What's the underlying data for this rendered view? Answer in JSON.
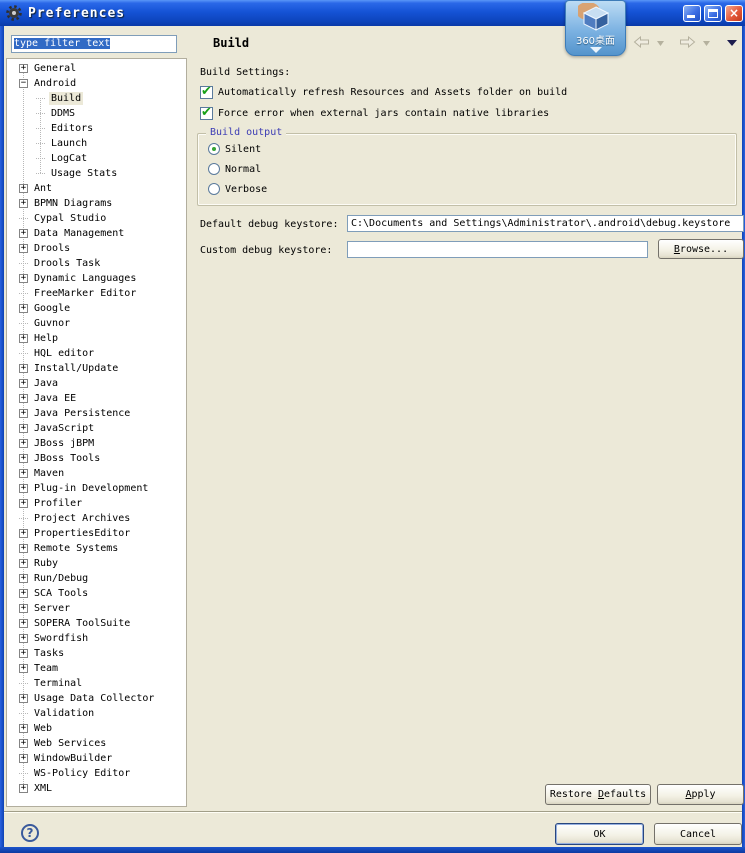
{
  "window": {
    "title": "Preferences"
  },
  "titlebar_controls": {
    "minimize": "minimize",
    "maximize": "maximize",
    "close": "close"
  },
  "overlay_widget": {
    "label": "360桌面"
  },
  "filter": {
    "value": "type filter text"
  },
  "page": {
    "title": "Build"
  },
  "tree": {
    "items": [
      {
        "label": "General",
        "expand": "plus",
        "level": 0,
        "selected": false
      },
      {
        "label": "Android",
        "expand": "minus",
        "level": 0,
        "selected": false
      },
      {
        "label": "Build",
        "expand": "leaf",
        "level": 1,
        "selected": true
      },
      {
        "label": "DDMS",
        "expand": "leaf",
        "level": 1,
        "selected": false
      },
      {
        "label": "Editors",
        "expand": "leaf",
        "level": 1,
        "selected": false
      },
      {
        "label": "Launch",
        "expand": "leaf",
        "level": 1,
        "selected": false
      },
      {
        "label": "LogCat",
        "expand": "leaf",
        "level": 1,
        "selected": false
      },
      {
        "label": "Usage Stats",
        "expand": "leaf",
        "level": 1,
        "selected": false
      },
      {
        "label": "Ant",
        "expand": "plus",
        "level": 0,
        "selected": false
      },
      {
        "label": "BPMN Diagrams",
        "expand": "plus",
        "level": 0,
        "selected": false
      },
      {
        "label": "Cypal Studio",
        "expand": "leaf",
        "level": 0,
        "selected": false
      },
      {
        "label": "Data Management",
        "expand": "plus",
        "level": 0,
        "selected": false
      },
      {
        "label": "Drools",
        "expand": "plus",
        "level": 0,
        "selected": false
      },
      {
        "label": "Drools Task",
        "expand": "leaf",
        "level": 0,
        "selected": false
      },
      {
        "label": "Dynamic Languages",
        "expand": "plus",
        "level": 0,
        "selected": false
      },
      {
        "label": "FreeMarker Editor",
        "expand": "leaf",
        "level": 0,
        "selected": false
      },
      {
        "label": "Google",
        "expand": "plus",
        "level": 0,
        "selected": false
      },
      {
        "label": "Guvnor",
        "expand": "leaf",
        "level": 0,
        "selected": false
      },
      {
        "label": "Help",
        "expand": "plus",
        "level": 0,
        "selected": false
      },
      {
        "label": "HQL editor",
        "expand": "leaf",
        "level": 0,
        "selected": false
      },
      {
        "label": "Install/Update",
        "expand": "plus",
        "level": 0,
        "selected": false
      },
      {
        "label": "Java",
        "expand": "plus",
        "level": 0,
        "selected": false
      },
      {
        "label": "Java EE",
        "expand": "plus",
        "level": 0,
        "selected": false
      },
      {
        "label": "Java Persistence",
        "expand": "plus",
        "level": 0,
        "selected": false
      },
      {
        "label": "JavaScript",
        "expand": "plus",
        "level": 0,
        "selected": false
      },
      {
        "label": "JBoss jBPM",
        "expand": "plus",
        "level": 0,
        "selected": false
      },
      {
        "label": "JBoss Tools",
        "expand": "plus",
        "level": 0,
        "selected": false
      },
      {
        "label": "Maven",
        "expand": "plus",
        "level": 0,
        "selected": false
      },
      {
        "label": "Plug-in Development",
        "expand": "plus",
        "level": 0,
        "selected": false
      },
      {
        "label": "Profiler",
        "expand": "plus",
        "level": 0,
        "selected": false
      },
      {
        "label": "Project Archives",
        "expand": "leaf",
        "level": 0,
        "selected": false
      },
      {
        "label": "PropertiesEditor",
        "expand": "plus",
        "level": 0,
        "selected": false
      },
      {
        "label": "Remote Systems",
        "expand": "plus",
        "level": 0,
        "selected": false
      },
      {
        "label": "Ruby",
        "expand": "plus",
        "level": 0,
        "selected": false
      },
      {
        "label": "Run/Debug",
        "expand": "plus",
        "level": 0,
        "selected": false
      },
      {
        "label": "SCA Tools",
        "expand": "plus",
        "level": 0,
        "selected": false
      },
      {
        "label": "Server",
        "expand": "plus",
        "level": 0,
        "selected": false
      },
      {
        "label": "SOPERA ToolSuite",
        "expand": "plus",
        "level": 0,
        "selected": false
      },
      {
        "label": "Swordfish",
        "expand": "plus",
        "level": 0,
        "selected": false
      },
      {
        "label": "Tasks",
        "expand": "plus",
        "level": 0,
        "selected": false
      },
      {
        "label": "Team",
        "expand": "plus",
        "level": 0,
        "selected": false
      },
      {
        "label": "Terminal",
        "expand": "leaf",
        "level": 0,
        "selected": false
      },
      {
        "label": "Usage Data Collector",
        "expand": "plus",
        "level": 0,
        "selected": false
      },
      {
        "label": "Validation",
        "expand": "leaf",
        "level": 0,
        "selected": false
      },
      {
        "label": "Web",
        "expand": "plus",
        "level": 0,
        "selected": false
      },
      {
        "label": "Web Services",
        "expand": "plus",
        "level": 0,
        "selected": false
      },
      {
        "label": "WindowBuilder",
        "expand": "plus",
        "level": 0,
        "selected": false
      },
      {
        "label": "WS-Policy Editor",
        "expand": "leaf",
        "level": 0,
        "selected": false
      },
      {
        "label": "XML",
        "expand": "plus",
        "level": 0,
        "selected": false
      }
    ]
  },
  "build_settings": {
    "label": "Build Settings:",
    "checkboxes": [
      {
        "label": "Automatically refresh Resources and Assets folder on build",
        "checked": true
      },
      {
        "label": "Force error when external jars contain native libraries",
        "checked": true
      }
    ]
  },
  "build_output": {
    "title": "Build output",
    "options": [
      {
        "label": "Silent",
        "selected": true
      },
      {
        "label": "Normal",
        "selected": false
      },
      {
        "label": "Verbose",
        "selected": false
      }
    ]
  },
  "keystore": {
    "default_label": "Default debug keystore:",
    "default_value": "C:\\Documents and Settings\\Administrator\\.android\\debug.keystore",
    "custom_label": "Custom debug keystore:",
    "custom_value": "",
    "browse": {
      "label": "Browse...",
      "mnemonic": "B"
    }
  },
  "action_buttons": {
    "restore_defaults": {
      "label": "Restore Defaults",
      "mnemonic": "D"
    },
    "apply": {
      "label": "Apply",
      "mnemonic": "A"
    }
  },
  "dialog_buttons": {
    "ok": "OK",
    "cancel": "Cancel",
    "help_glyph": "?"
  },
  "colors": {
    "background": "#ece9d8",
    "titlebar_blue": "#1553d6",
    "selection_blue": "#316AC5",
    "check_green": "#18a018",
    "radio_green": "#35a335",
    "close_red": "#e4593a",
    "group_title_blue": "#3c3cb4"
  }
}
